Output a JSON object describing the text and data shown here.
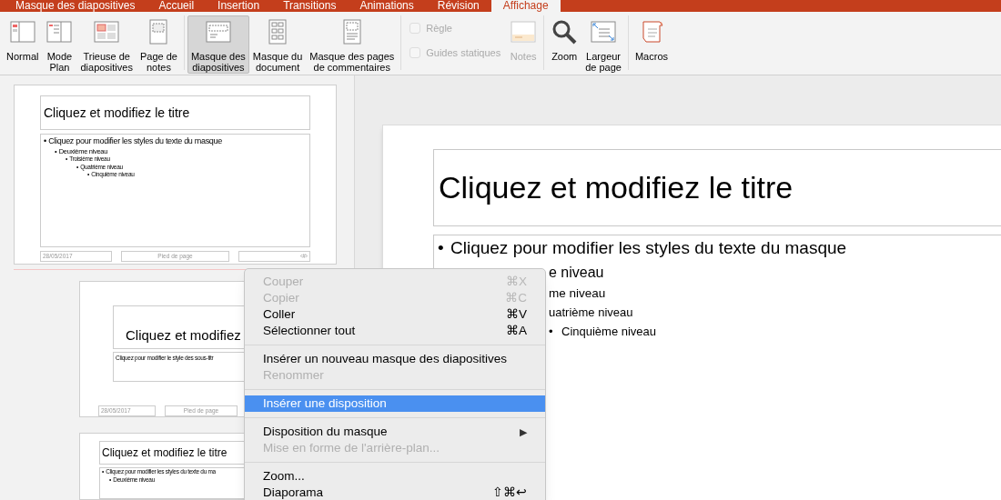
{
  "tabs": [
    {
      "label": "Masque des diapositives",
      "selected": false
    },
    {
      "label": "Accueil",
      "selected": false
    },
    {
      "label": "Insertion",
      "selected": false
    },
    {
      "label": "Transitions",
      "selected": false
    },
    {
      "label": "Animations",
      "selected": false
    },
    {
      "label": "Révision",
      "selected": false
    },
    {
      "label": "Affichage",
      "selected": true
    }
  ],
  "ribbon": {
    "groups": [
      {
        "items": [
          {
            "kind": "button",
            "label": "Normal",
            "selected": false,
            "disabled": false
          },
          {
            "kind": "button",
            "label": "Mode\nPlan",
            "selected": false,
            "disabled": false
          },
          {
            "kind": "button",
            "label": "Trieuse de\ndiapositives",
            "selected": false,
            "disabled": false
          },
          {
            "kind": "button",
            "label": "Page de\nnotes",
            "selected": false,
            "disabled": false
          }
        ]
      },
      {
        "items": [
          {
            "kind": "button",
            "label": "Masque des\ndiapositives",
            "selected": true,
            "disabled": false
          },
          {
            "kind": "button",
            "label": "Masque du\ndocument",
            "selected": false,
            "disabled": false
          },
          {
            "kind": "button",
            "label": "Masque des pages\nde commentaires",
            "selected": false,
            "disabled": false
          }
        ]
      },
      {
        "items": [
          {
            "kind": "checks",
            "checks": [
              {
                "label": "Règle",
                "checked": false,
                "disabled": true
              },
              {
                "label": "Guides statiques",
                "checked": false,
                "disabled": true
              }
            ]
          },
          {
            "kind": "button",
            "label": "Notes",
            "selected": false,
            "disabled": true
          }
        ]
      },
      {
        "items": [
          {
            "kind": "button",
            "label": "Zoom",
            "selected": false,
            "disabled": false
          },
          {
            "kind": "button",
            "label": "Largeur\nde page",
            "selected": false,
            "disabled": false
          }
        ]
      },
      {
        "items": [
          {
            "kind": "button",
            "label": "Macros",
            "selected": false,
            "disabled": false
          }
        ]
      }
    ]
  },
  "thumbnails": [
    {
      "kind": "master",
      "title": "Cliquez et modifiez le titre",
      "body": [
        {
          "bullet": "•",
          "text": "Cliquez pour modifier les styles du texte du masque",
          "children": [
            {
              "bullet": "•",
              "text": "Deuxième niveau",
              "children": [
                {
                  "bullet": "•",
                  "text": "Troisième niveau",
                  "children": [
                    {
                      "bullet": "•",
                      "text": "Quatrième niveau",
                      "children": [
                        {
                          "bullet": "•",
                          "text": "Cinquième niveau"
                        }
                      ]
                    }
                  ]
                }
              ]
            }
          ]
        }
      ],
      "footer": [
        "28/05/2017",
        "Pied de page",
        "‹#›"
      ]
    },
    {
      "kind": "title_layout",
      "title": "Cliquez et modifiez",
      "subtitle": "Cliquez pour modifier le style des sous-titr",
      "footer": [
        "28/05/2017",
        "Pied de page"
      ]
    },
    {
      "kind": "content_layout",
      "title": "Cliquez et modifiez le titre",
      "body": [
        {
          "bullet": "•",
          "text": "Cliquez pour modifier les styles du texte du ma",
          "children": [
            {
              "bullet": "•",
              "text": "Deuxième niveau"
            }
          ]
        }
      ]
    }
  ],
  "slide": {
    "title": "Cliquez et modifiez le titre",
    "body": [
      {
        "bullet": "•",
        "text": "Cliquez pour modifier les styles du texte du masque",
        "children": [
          {
            "text": "e niveau",
            "children": [
              {
                "text": "me niveau",
                "children": [
                  {
                    "text": "uatrième niveau",
                    "children": [
                      {
                        "bullet": "•",
                        "text": "Cinquième niveau"
                      }
                    ]
                  }
                ]
              }
            ]
          }
        ]
      }
    ]
  },
  "context_menu": {
    "items": [
      {
        "kind": "item",
        "label": "Couper",
        "shortcut": "⌘X",
        "disabled": true,
        "selected": false
      },
      {
        "kind": "item",
        "label": "Copier",
        "shortcut": "⌘C",
        "disabled": true,
        "selected": false
      },
      {
        "kind": "item",
        "label": "Coller",
        "shortcut": "⌘V",
        "disabled": false,
        "selected": false
      },
      {
        "kind": "item",
        "label": "Sélectionner tout",
        "shortcut": "⌘A",
        "disabled": false,
        "selected": false
      },
      {
        "kind": "separator"
      },
      {
        "kind": "item",
        "label": "Insérer un nouveau masque des diapositives",
        "disabled": false,
        "selected": false
      },
      {
        "kind": "item",
        "label": "Renommer",
        "disabled": true,
        "selected": false
      },
      {
        "kind": "separator"
      },
      {
        "kind": "item",
        "label": "Insérer une disposition",
        "disabled": false,
        "selected": true
      },
      {
        "kind": "separator"
      },
      {
        "kind": "item",
        "label": "Disposition du masque",
        "submenu": "▶",
        "disabled": false,
        "selected": false
      },
      {
        "kind": "item",
        "label": "Mise en forme de l'arrière-plan...",
        "disabled": true,
        "selected": false
      },
      {
        "kind": "separator"
      },
      {
        "kind": "item",
        "label": "Zoom...",
        "disabled": false,
        "selected": false
      },
      {
        "kind": "item",
        "label": "Diaporama",
        "shortcut": "⇧⌘↩",
        "disabled": false,
        "selected": false
      }
    ]
  }
}
